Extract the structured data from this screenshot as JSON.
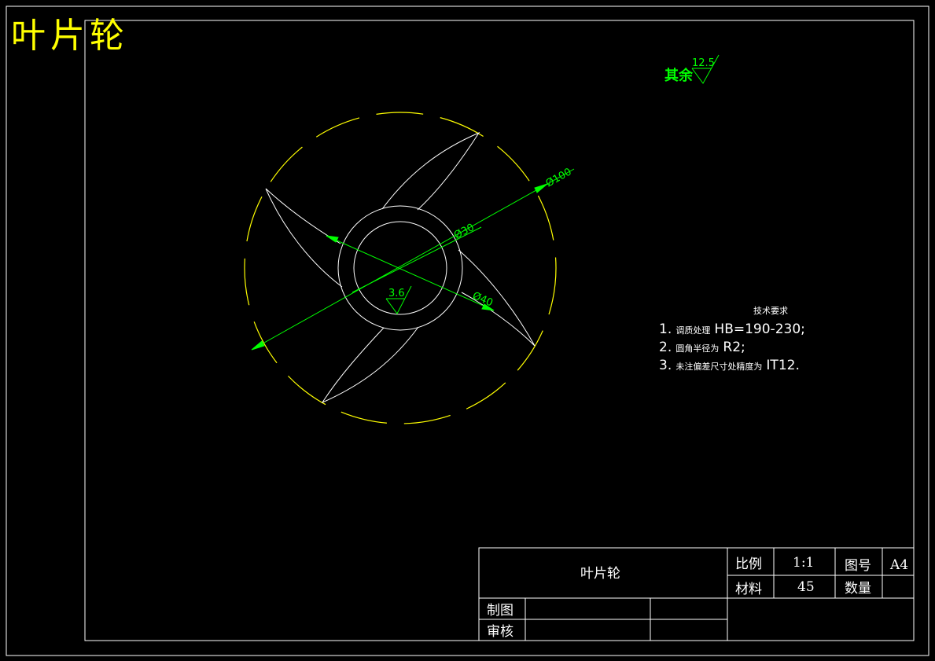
{
  "colors": {
    "background": "#000000",
    "frame": "#ffffff",
    "drawing_line": "#ffffff",
    "center_line": "#ffff00",
    "dimension": "#00ff00",
    "title_big": "#ffff00",
    "text": "#ffffff"
  },
  "header": {
    "title": "叶片轮"
  },
  "surface_roughness": {
    "label": "其余",
    "value": "12.5"
  },
  "dimensions": {
    "outer_diameter": "Ø100",
    "hub_outer_diameter": "Ø40",
    "hub_inner_diameter": "Ø30",
    "hub_roughness": "3.6"
  },
  "tech_requirements": {
    "heading": "技术要求",
    "items": [
      {
        "num": "1.",
        "text": "调质处理",
        "spec": "HB=190-230;"
      },
      {
        "num": "2.",
        "text": "圆角半径为",
        "spec": "R2;"
      },
      {
        "num": "3.",
        "text": "未注偏差尺寸处精度为",
        "spec": "IT12."
      }
    ]
  },
  "title_block": {
    "part_name": "叶片轮",
    "scale_label": "比例",
    "scale_value": "1:1",
    "drawing_no_label": "图号",
    "drawing_no_value": "A4",
    "material_label": "材料",
    "material_value": "45",
    "quantity_label": "数量",
    "quantity_value": "",
    "drawn_label": "制图",
    "checked_label": "审核"
  }
}
